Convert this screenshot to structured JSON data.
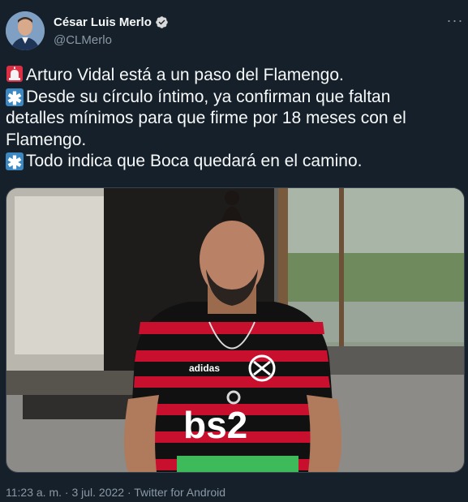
{
  "author": {
    "display_name": "César Luis Merlo",
    "handle": "@CLMerlo",
    "verified": true,
    "verified_icon": "verified-badge-icon",
    "avatar_icon": "profile-avatar"
  },
  "more_options": "···",
  "tweet_lines": [
    {
      "emoji": "siren-emoji-icon",
      "text": "Arturo Vidal está a un paso del Flamengo."
    },
    {
      "emoji": "asterisk-emoji-icon",
      "text": "Desde su círculo íntimo, ya confirman que faltan"
    },
    {
      "emoji": null,
      "text": "detalles mínimos para que firme por 18 meses con el"
    },
    {
      "emoji": null,
      "text": "Flamengo."
    },
    {
      "emoji": "asterisk-emoji-icon",
      "text": "Todo indica que Boca quedará en el camino."
    }
  ],
  "media": {
    "jersey_sponsor": "bs2",
    "jersey_brand": "adidas"
  },
  "timestamp": "11:23 a. m. · 3 jul. 2022 · Twitter for Android",
  "colors": {
    "background": "#15202b",
    "text": "#f7f9f9",
    "secondary_text": "#8b98a5",
    "border": "#38444d",
    "accent": "#1d9bf0"
  }
}
